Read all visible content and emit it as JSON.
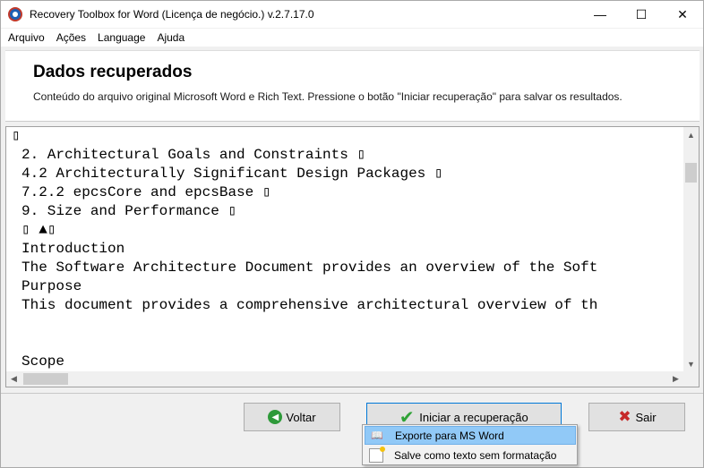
{
  "window": {
    "title": "Recovery Toolbox for Word (Licença de negócio.) v.2.7.17.0",
    "controls": {
      "minimize": "—",
      "maximize": "☐",
      "close": "✕"
    }
  },
  "menu": {
    "items": [
      "Arquivo",
      "Ações",
      "Language",
      "Ajuda"
    ]
  },
  "header": {
    "title": "Dados recuperados",
    "description": "Conteúdo do arquivo original Microsoft Word e Rich Text. Pressione o botão \"Iniciar recuperação\" para salvar os resultados."
  },
  "content": {
    "lines": [
      "▯",
      "2. Architectural Goals and Constraints ▯",
      "4.2 Architecturally Significant Design Packages ▯",
      "7.2.2 epcsCore and epcsBase ▯",
      "9. Size and Performance ▯",
      "▯ ▲▯",
      "Introduction",
      "The Software Architecture Document provides an overview of the Soft",
      "Purpose",
      "This document provides a comprehensive architectural overview of th",
      "",
      "",
      "Scope"
    ]
  },
  "buttons": {
    "back": "Voltar",
    "start": "Iniciar a recuperação",
    "exit": "Sair"
  },
  "dropdown": {
    "items": [
      "Exporte para MS Word",
      "Salve como texto sem formatação"
    ]
  },
  "icons": {
    "back": "back-arrow-icon",
    "start": "checkmark-icon",
    "exit": "red-x-icon",
    "export_word": "book-icon",
    "save_text": "text-file-icon"
  },
  "colors": {
    "accent": "#0078d7",
    "menu_highlight": "#91c9f7",
    "check_green": "#2fa236",
    "exit_red": "#c62828"
  }
}
